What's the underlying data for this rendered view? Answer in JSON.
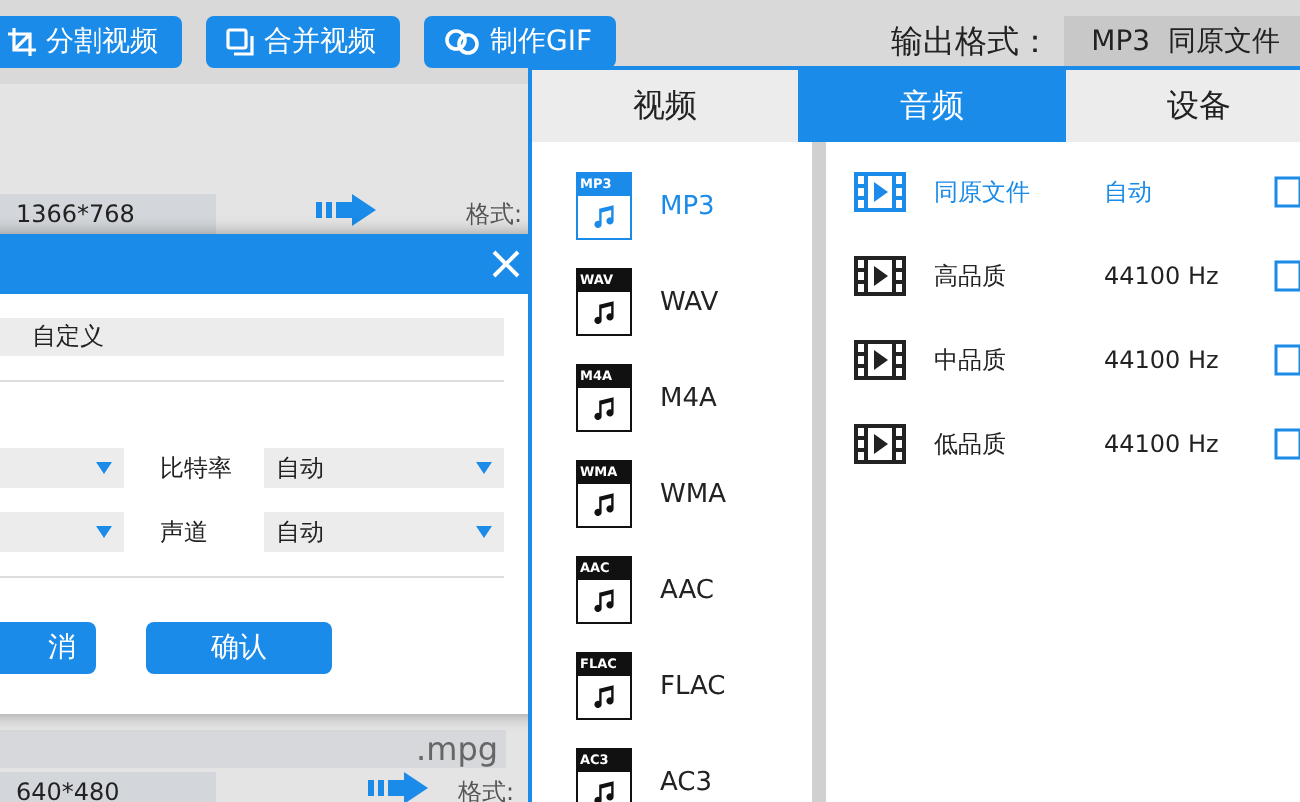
{
  "toolbar": {
    "buttons": [
      {
        "label": "分割视频"
      },
      {
        "label": "合并视频"
      },
      {
        "label": "制作GIF"
      }
    ],
    "output_format_label": "输出格式：",
    "output_format_value": "MP3  同原文件"
  },
  "files": [
    {
      "resolution": "1366*768",
      "format_label": "格式:"
    },
    {
      "name": ".mpg",
      "resolution": "640*480",
      "format_label": "格式:"
    }
  ],
  "dialog": {
    "field_value": "自定义",
    "rows": [
      {
        "label": "比特率",
        "value": "自动"
      },
      {
        "label": "声道",
        "value": "自动"
      }
    ],
    "buttons": [
      {
        "label": "消"
      },
      {
        "label": "确认"
      }
    ]
  },
  "format_popup": {
    "tabs": [
      {
        "label": "视频",
        "selected": false
      },
      {
        "label": "音频",
        "selected": true
      },
      {
        "label": "设备",
        "selected": false
      }
    ],
    "formats": [
      {
        "icon_label": "MP3",
        "name": "MP3",
        "selected": true
      },
      {
        "icon_label": "WAV",
        "name": "WAV",
        "selected": false
      },
      {
        "icon_label": "M4A",
        "name": "M4A",
        "selected": false
      },
      {
        "icon_label": "WMA",
        "name": "WMA",
        "selected": false
      },
      {
        "icon_label": "AAC",
        "name": "AAC",
        "selected": false
      },
      {
        "icon_label": "FLAC",
        "name": "FLAC",
        "selected": false
      },
      {
        "icon_label": "AC3",
        "name": "AC3",
        "selected": false
      }
    ],
    "presets": [
      {
        "name": "同原文件",
        "rate": "自动",
        "selected": true
      },
      {
        "name": "高品质",
        "rate": "44100 Hz",
        "selected": false
      },
      {
        "name": "中品质",
        "rate": "44100 Hz",
        "selected": false
      },
      {
        "name": "低品质",
        "rate": "44100 Hz",
        "selected": false
      }
    ]
  }
}
